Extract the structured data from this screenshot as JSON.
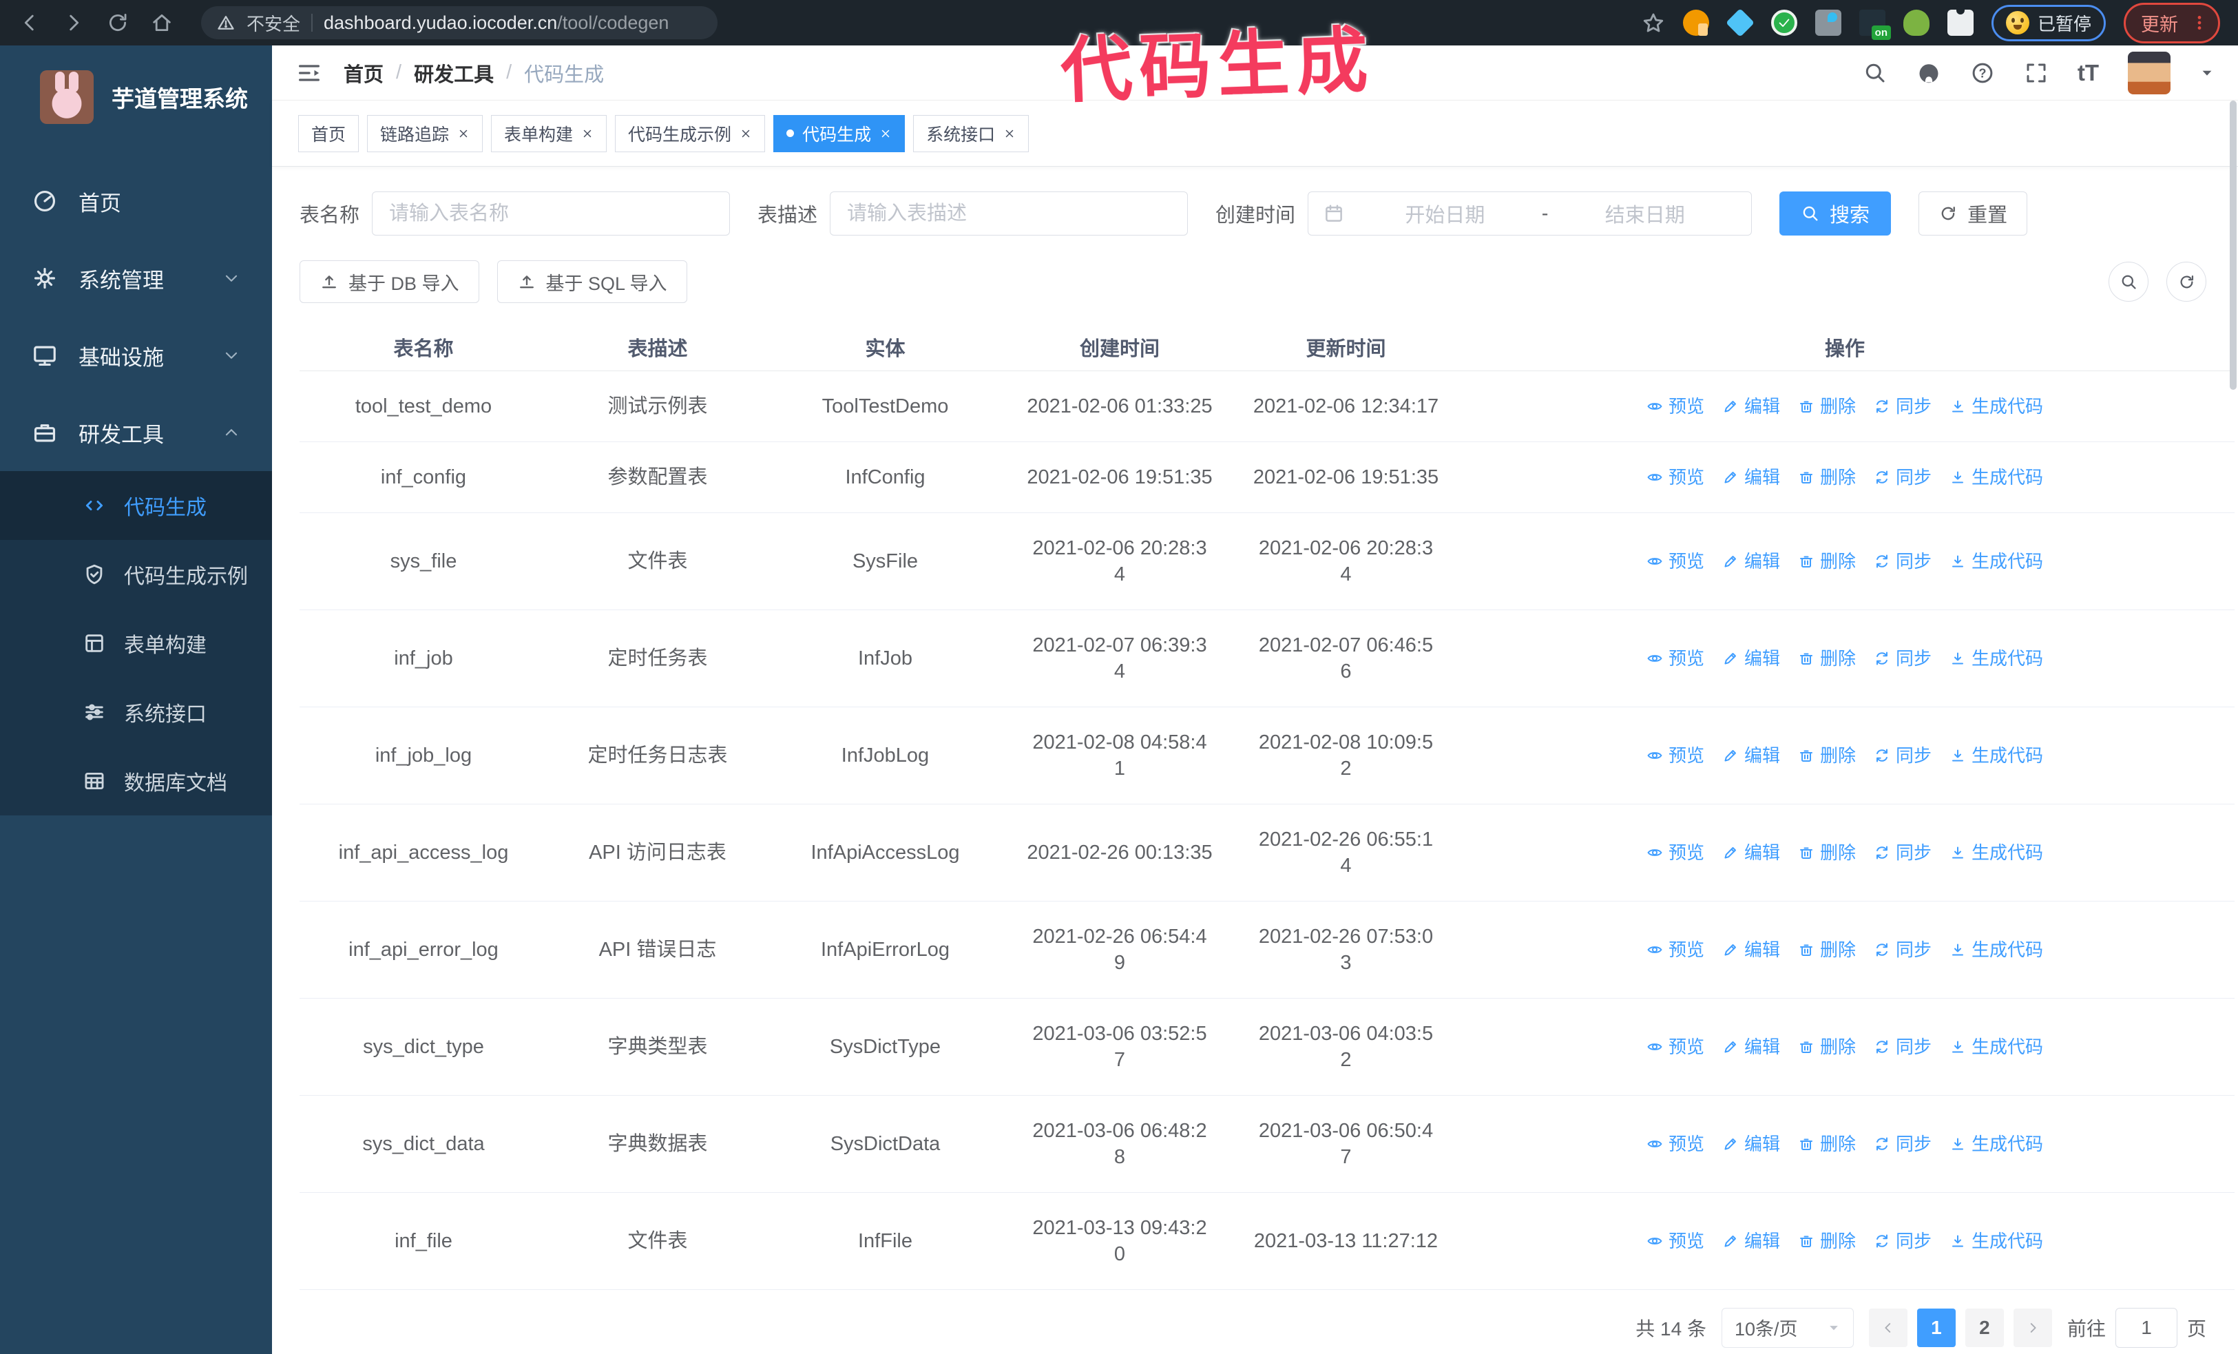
{
  "browser": {
    "security_label": "不安全",
    "url_domain": "dashboard.yudao.iocoder.cn",
    "url_path": "/tool/codegen",
    "extension_on_label": "on",
    "paused_label": "已暂停",
    "update_label": "更新"
  },
  "watermark": "代码生成",
  "sidebar": {
    "app_title": "芋道管理系统",
    "items": [
      {
        "key": "home",
        "label": "首页",
        "icon": "dashboard",
        "chevron": null
      },
      {
        "key": "system",
        "label": "系统管理",
        "icon": "gear",
        "chevron": "down"
      },
      {
        "key": "infra",
        "label": "基础设施",
        "icon": "monitor",
        "chevron": "down"
      },
      {
        "key": "devtools",
        "label": "研发工具",
        "icon": "toolbox",
        "chevron": "up"
      }
    ],
    "submenu": [
      {
        "key": "codegen",
        "label": "代码生成",
        "icon": "code",
        "active": true
      },
      {
        "key": "codegen-example",
        "label": "代码生成示例",
        "icon": "shield-check",
        "active": false
      },
      {
        "key": "form-builder",
        "label": "表单构建",
        "icon": "form",
        "active": false
      },
      {
        "key": "system-api",
        "label": "系统接口",
        "icon": "sliders",
        "active": false
      },
      {
        "key": "db-doc",
        "label": "数据库文档",
        "icon": "dbdoc",
        "active": false
      }
    ]
  },
  "header": {
    "breadcrumb": [
      "首页",
      "研发工具",
      "代码生成"
    ],
    "font_icon_label": "tT"
  },
  "tabs": [
    {
      "label": "首页",
      "closable": false,
      "active": false
    },
    {
      "label": "链路追踪",
      "closable": true,
      "active": false
    },
    {
      "label": "表单构建",
      "closable": true,
      "active": false
    },
    {
      "label": "代码生成示例",
      "closable": true,
      "active": false
    },
    {
      "label": "代码生成",
      "closable": true,
      "active": true
    },
    {
      "label": "系统接口",
      "closable": true,
      "active": false
    }
  ],
  "filters": {
    "table_name_label": "表名称",
    "table_name_placeholder": "请输入表名称",
    "table_desc_label": "表描述",
    "table_desc_placeholder": "请输入表描述",
    "create_time_label": "创建时间",
    "start_date_placeholder": "开始日期",
    "range_separator": "-",
    "end_date_placeholder": "结束日期",
    "search_label": "搜索",
    "reset_label": "重置"
  },
  "toolbar": {
    "import_db_label": "基于 DB 导入",
    "import_sql_label": "基于 SQL 导入"
  },
  "table": {
    "columns": [
      "表名称",
      "表描述",
      "实体",
      "创建时间",
      "更新时间",
      "操作"
    ],
    "actions": [
      "预览",
      "编辑",
      "删除",
      "同步",
      "生成代码"
    ],
    "rows": [
      {
        "name": "tool_test_demo",
        "desc": "测试示例表",
        "entity": "ToolTestDemo",
        "created": "2021-02-06 01:33:25",
        "created_wrap": false,
        "updated": "2021-02-06 12:34:17",
        "updated_wrap": false
      },
      {
        "name": "inf_config",
        "desc": "参数配置表",
        "entity": "InfConfig",
        "created": "2021-02-06 19:51:35",
        "created_wrap": false,
        "updated": "2021-02-06 19:51:35",
        "updated_wrap": false
      },
      {
        "name": "sys_file",
        "desc": "文件表",
        "entity": "SysFile",
        "created": "2021-02-06 20:28:34",
        "created_wrap": true,
        "updated": "2021-02-06 20:28:34",
        "updated_wrap": true
      },
      {
        "name": "inf_job",
        "desc": "定时任务表",
        "entity": "InfJob",
        "created": "2021-02-07 06:39:34",
        "created_wrap": true,
        "updated": "2021-02-07 06:46:56",
        "updated_wrap": true
      },
      {
        "name": "inf_job_log",
        "desc": "定时任务日志表",
        "entity": "InfJobLog",
        "created": "2021-02-08 04:58:41",
        "created_wrap": true,
        "updated": "2021-02-08 10:09:52",
        "updated_wrap": true
      },
      {
        "name": "inf_api_access_log",
        "desc": "API 访问日志表",
        "entity": "InfApiAccessLog",
        "created": "2021-02-26 00:13:35",
        "created_wrap": false,
        "updated": "2021-02-26 06:55:14",
        "updated_wrap": true
      },
      {
        "name": "inf_api_error_log",
        "desc": "API 错误日志",
        "entity": "InfApiErrorLog",
        "created": "2021-02-26 06:54:49",
        "created_wrap": true,
        "updated": "2021-02-26 07:53:03",
        "updated_wrap": true
      },
      {
        "name": "sys_dict_type",
        "desc": "字典类型表",
        "entity": "SysDictType",
        "created": "2021-03-06 03:52:57",
        "created_wrap": true,
        "updated": "2021-03-06 04:03:52",
        "updated_wrap": true
      },
      {
        "name": "sys_dict_data",
        "desc": "字典数据表",
        "entity": "SysDictData",
        "created": "2021-03-06 06:48:28",
        "created_wrap": true,
        "updated": "2021-03-06 06:50:47",
        "updated_wrap": true
      },
      {
        "name": "inf_file",
        "desc": "文件表",
        "entity": "InfFile",
        "created": "2021-03-13 09:43:20",
        "created_wrap": true,
        "updated": "2021-03-13 11:27:12",
        "updated_wrap": false
      }
    ]
  },
  "pagination": {
    "total_text": "共 14 条",
    "page_size_label": "10条/页",
    "pages": [
      "1",
      "2"
    ],
    "active_page": "1",
    "goto_label": "前往",
    "goto_value": "1",
    "page_suffix": "页"
  }
}
